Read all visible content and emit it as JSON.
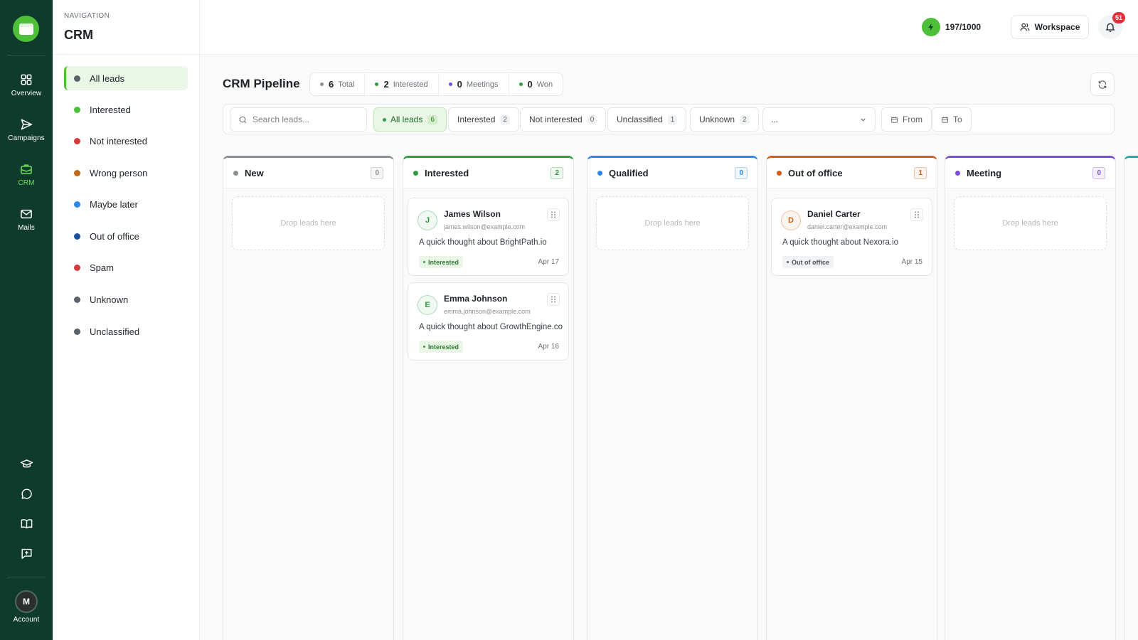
{
  "rail": {
    "items": [
      {
        "label": "Overview",
        "icon": "grid-icon"
      },
      {
        "label": "Campaigns",
        "icon": "send-icon"
      },
      {
        "label": "CRM",
        "icon": "briefcase-icon"
      },
      {
        "label": "Mails",
        "icon": "mail-icon"
      }
    ],
    "account_label": "Account",
    "account_initial": "M"
  },
  "nav": {
    "kicker": "NAVIGATION",
    "title": "CRM",
    "items": [
      {
        "label": "All leads",
        "color": "#5b6168"
      },
      {
        "label": "Interested",
        "color": "#4cc23a"
      },
      {
        "label": "Not interested",
        "color": "#d43a3a"
      },
      {
        "label": "Wrong person",
        "color": "#c2681a"
      },
      {
        "label": "Maybe later",
        "color": "#2f86eb"
      },
      {
        "label": "Out of office",
        "color": "#1d4fa0"
      },
      {
        "label": "Spam",
        "color": "#d43a3a"
      },
      {
        "label": "Unknown",
        "color": "#5b6168"
      },
      {
        "label": "Unclassified",
        "color": "#5b6168"
      }
    ]
  },
  "header": {
    "credits": "197/1000",
    "workspace_label": "Workspace",
    "notification_count": "51"
  },
  "pipeline": {
    "title": "CRM Pipeline",
    "stats": [
      {
        "value": "6",
        "label": "Total",
        "color": "#8a9096"
      },
      {
        "value": "2",
        "label": "Interested",
        "color": "#2e9e44"
      },
      {
        "value": "0",
        "label": "Meetings",
        "color": "#7c4ddb"
      },
      {
        "value": "0",
        "label": "Won",
        "color": "#2e9e44"
      }
    ]
  },
  "filters": {
    "search_placeholder": "Search leads...",
    "chips": [
      {
        "label": "All leads",
        "count": "6"
      },
      {
        "label": "Interested",
        "count": "2"
      },
      {
        "label": "Not interested",
        "count": "0"
      },
      {
        "label": "Unclassified",
        "count": "1"
      },
      {
        "label": "Unknown",
        "count": "2"
      }
    ],
    "select_value": "...",
    "from_label": "From",
    "to_label": "To"
  },
  "columns": [
    {
      "title": "New",
      "count": "0",
      "color": "#8a9096",
      "empty_text": "Drop leads here"
    },
    {
      "title": "Interested",
      "count": "2",
      "color": "#2e9e44",
      "cards": [
        {
          "initial": "J",
          "name": "James Wilson",
          "email": "james.wilson@example.com",
          "snippet": "A quick thought about BrightPath.io",
          "tag": "Interested",
          "date": "Apr 17"
        },
        {
          "initial": "E",
          "name": "Emma Johnson",
          "email": "emma.johnson@example.com",
          "snippet": "A quick thought about GrowthEngine.co",
          "tag": "Interested",
          "date": "Apr 16"
        }
      ]
    },
    {
      "title": "Qualified",
      "count": "0",
      "color": "#2f86eb",
      "empty_text": "Drop leads here"
    },
    {
      "title": "Out of office",
      "count": "1",
      "color": "#d1601a",
      "cards": [
        {
          "initial": "D",
          "name": "Daniel Carter",
          "email": "daniel.carter@example.com",
          "snippet": "A quick thought about Nexora.io",
          "tag": "Out of office",
          "date": "Apr 15"
        }
      ]
    },
    {
      "title": "Meeting",
      "count": "0",
      "color": "#7c4ddb",
      "empty_text": "Drop leads here"
    }
  ]
}
